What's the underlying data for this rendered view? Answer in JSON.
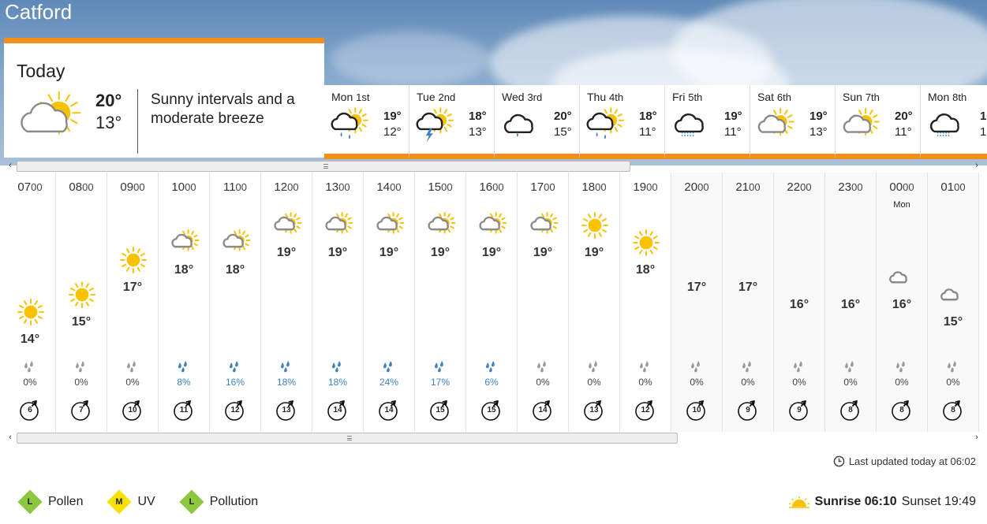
{
  "location": "Catford",
  "colors": {
    "accent": "#f39019",
    "sun": "#f9c200",
    "cloud": "#8a8a8a",
    "rain": "#3b82c4"
  },
  "today": {
    "title": "Today",
    "max": "20°",
    "min": "13°",
    "description": "Sunny intervals and a moderate breeze",
    "icon": "sunny-intervals-icon"
  },
  "days": [
    {
      "name": "Mon",
      "date": "1st",
      "max": "19°",
      "min": "12°",
      "icon": "light-rain-sun-icon"
    },
    {
      "name": "Tue",
      "date": "2nd",
      "max": "18°",
      "min": "13°",
      "icon": "thunder-sun-icon"
    },
    {
      "name": "Wed",
      "date": "3rd",
      "max": "20°",
      "min": "15°",
      "icon": "light-rain-icon"
    },
    {
      "name": "Thu",
      "date": "4th",
      "max": "18°",
      "min": "11°",
      "icon": "light-rain-sun-icon"
    },
    {
      "name": "Fri",
      "date": "5th",
      "max": "19°",
      "min": "11°",
      "icon": "drizzle-icon"
    },
    {
      "name": "Sat",
      "date": "6th",
      "max": "19°",
      "min": "13°",
      "icon": "sunny-intervals-icon"
    },
    {
      "name": "Sun",
      "date": "7th",
      "max": "20°",
      "min": "11°",
      "icon": "sunny-intervals-icon"
    },
    {
      "name": "Mon",
      "date": "8th",
      "max": "1",
      "min": "1",
      "icon": "drizzle-icon"
    }
  ],
  "hours": [
    {
      "big": "07",
      "small": "00",
      "day": "",
      "temp": "14°",
      "level": 14,
      "icon": "sunny-icon",
      "rain": "0%",
      "wind": "6",
      "night": false
    },
    {
      "big": "08",
      "small": "00",
      "day": "",
      "temp": "15°",
      "level": 15,
      "icon": "sunny-icon",
      "rain": "0%",
      "wind": "7",
      "night": false
    },
    {
      "big": "09",
      "small": "00",
      "day": "",
      "temp": "17°",
      "level": 17,
      "icon": "sunny-icon",
      "rain": "0%",
      "wind": "10",
      "night": false
    },
    {
      "big": "10",
      "small": "00",
      "day": "",
      "temp": "18°",
      "level": 18,
      "icon": "sunny-intervals-icon",
      "rain": "8%",
      "wind": "11",
      "night": false
    },
    {
      "big": "11",
      "small": "00",
      "day": "",
      "temp": "18°",
      "level": 18,
      "icon": "sunny-intervals-icon",
      "rain": "16%",
      "wind": "12",
      "night": false
    },
    {
      "big": "12",
      "small": "00",
      "day": "",
      "temp": "19°",
      "level": 19,
      "icon": "sunny-intervals-icon",
      "rain": "18%",
      "wind": "13",
      "night": false
    },
    {
      "big": "13",
      "small": "00",
      "day": "",
      "temp": "19°",
      "level": 19,
      "icon": "sunny-intervals-icon",
      "rain": "18%",
      "wind": "14",
      "night": false
    },
    {
      "big": "14",
      "small": "00",
      "day": "",
      "temp": "19°",
      "level": 19,
      "icon": "sunny-intervals-icon",
      "rain": "24%",
      "wind": "14",
      "night": false
    },
    {
      "big": "15",
      "small": "00",
      "day": "",
      "temp": "19°",
      "level": 19,
      "icon": "sunny-intervals-icon",
      "rain": "17%",
      "wind": "15",
      "night": false
    },
    {
      "big": "16",
      "small": "00",
      "day": "",
      "temp": "19°",
      "level": 19,
      "icon": "sunny-intervals-icon",
      "rain": "6%",
      "wind": "15",
      "night": false
    },
    {
      "big": "17",
      "small": "00",
      "day": "",
      "temp": "19°",
      "level": 19,
      "icon": "sunny-intervals-icon",
      "rain": "0%",
      "wind": "14",
      "night": false
    },
    {
      "big": "18",
      "small": "00",
      "day": "",
      "temp": "19°",
      "level": 19,
      "icon": "sunny-icon",
      "rain": "0%",
      "wind": "13",
      "night": false
    },
    {
      "big": "19",
      "small": "00",
      "day": "",
      "temp": "18°",
      "level": 18,
      "icon": "sunny-icon",
      "rain": "0%",
      "wind": "12",
      "night": false
    },
    {
      "big": "20",
      "small": "00",
      "day": "",
      "temp": "17°",
      "level": 17,
      "icon": "moon-icon",
      "rain": "0%",
      "wind": "10",
      "night": true
    },
    {
      "big": "21",
      "small": "00",
      "day": "",
      "temp": "17°",
      "level": 17,
      "icon": "moon-icon",
      "rain": "0%",
      "wind": "9",
      "night": true
    },
    {
      "big": "22",
      "small": "00",
      "day": "",
      "temp": "16°",
      "level": 16,
      "icon": "moon-icon",
      "rain": "0%",
      "wind": "9",
      "night": true
    },
    {
      "big": "23",
      "small": "00",
      "day": "",
      "temp": "16°",
      "level": 16,
      "icon": "moon-icon",
      "rain": "0%",
      "wind": "8",
      "night": true
    },
    {
      "big": "00",
      "small": "00",
      "day": "Mon",
      "temp": "16°",
      "level": 16,
      "icon": "partly-cloudy-night-icon",
      "rain": "0%",
      "wind": "8",
      "night": true
    },
    {
      "big": "01",
      "small": "00",
      "day": "",
      "temp": "15°",
      "level": 15,
      "icon": "partly-cloudy-night-icon",
      "rain": "0%",
      "wind": "8",
      "night": true
    }
  ],
  "updated": "Last updated today at 06:02",
  "badges": [
    {
      "letter": "L",
      "label": "Pollen",
      "color": "#8dc63f"
    },
    {
      "letter": "M",
      "label": "UV",
      "color": "#f5e200"
    },
    {
      "letter": "L",
      "label": "Pollution",
      "color": "#8dc63f"
    }
  ],
  "sun": {
    "sunrise": "Sunrise 06:10",
    "sunset": "Sunset 19:49"
  },
  "scrollbars": {
    "left": "‹",
    "right": "›"
  }
}
